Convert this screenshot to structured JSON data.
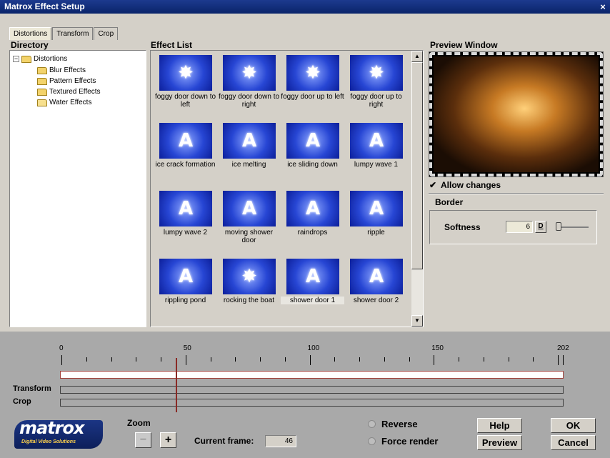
{
  "window": {
    "title": "Matrox Effect Setup",
    "close": "×"
  },
  "tabs": [
    {
      "label": "Distortions",
      "active": true
    },
    {
      "label": "Transform",
      "active": false
    },
    {
      "label": "Crop",
      "active": false
    }
  ],
  "directory": {
    "title": "Directory",
    "root": {
      "label": "Distortions",
      "expander": "−"
    },
    "items": [
      {
        "label": "Blur Effects"
      },
      {
        "label": "Pattern Effects"
      },
      {
        "label": "Textured Effects"
      },
      {
        "label": "Water Effects",
        "selected": true
      }
    ]
  },
  "effect_list": {
    "title": "Effect List",
    "items": [
      {
        "label": "foggy door down to left",
        "glyph": "✸"
      },
      {
        "label": "foggy door down to right",
        "glyph": "✸"
      },
      {
        "label": "foggy door up to left",
        "glyph": "✸"
      },
      {
        "label": "foggy door up to right",
        "glyph": "✸"
      },
      {
        "label": "ice crack formation",
        "glyph": "A"
      },
      {
        "label": "ice melting",
        "glyph": "A"
      },
      {
        "label": "ice sliding down",
        "glyph": "A"
      },
      {
        "label": "lumpy wave 1",
        "glyph": "A"
      },
      {
        "label": "lumpy wave 2",
        "glyph": "A"
      },
      {
        "label": "moving shower door",
        "glyph": "A"
      },
      {
        "label": "raindrops",
        "glyph": "A"
      },
      {
        "label": "ripple",
        "glyph": "A"
      },
      {
        "label": "rippling pond",
        "glyph": "A"
      },
      {
        "label": "rocking the boat",
        "glyph": "✸"
      },
      {
        "label": "shower door 1",
        "glyph": "A",
        "selected": true
      },
      {
        "label": "shower door 2",
        "glyph": "A"
      }
    ]
  },
  "preview": {
    "title": "Preview Window"
  },
  "allow_changes": {
    "label": "Allow changes",
    "checked": true,
    "mark": "✔"
  },
  "border": {
    "title": "Border",
    "softness_label": "Softness",
    "softness_value": "6",
    "default_button": "D"
  },
  "timeline": {
    "ruler_labels": [
      "0",
      "50",
      "100",
      "150",
      "202"
    ],
    "transform_label": "Transform",
    "crop_label": "Crop",
    "current_frame": 46,
    "total_frames": 202
  },
  "logo": {
    "brand": "matrox",
    "tagline": "Digital Video Solutions"
  },
  "zoom": {
    "label": "Zoom",
    "minus": "−",
    "plus": "+"
  },
  "current_frame": {
    "label": "Current frame:",
    "value": "46"
  },
  "options": {
    "reverse": "Reverse",
    "force_render": "Force render"
  },
  "buttons": {
    "help": "Help",
    "ok": "OK",
    "preview": "Preview",
    "cancel": "Cancel"
  },
  "colors": {
    "titlebar": "#0a246a",
    "panel": "#d4d0c8",
    "timeline_bg": "#a9a9a9",
    "cursor": "#8a2a26"
  }
}
